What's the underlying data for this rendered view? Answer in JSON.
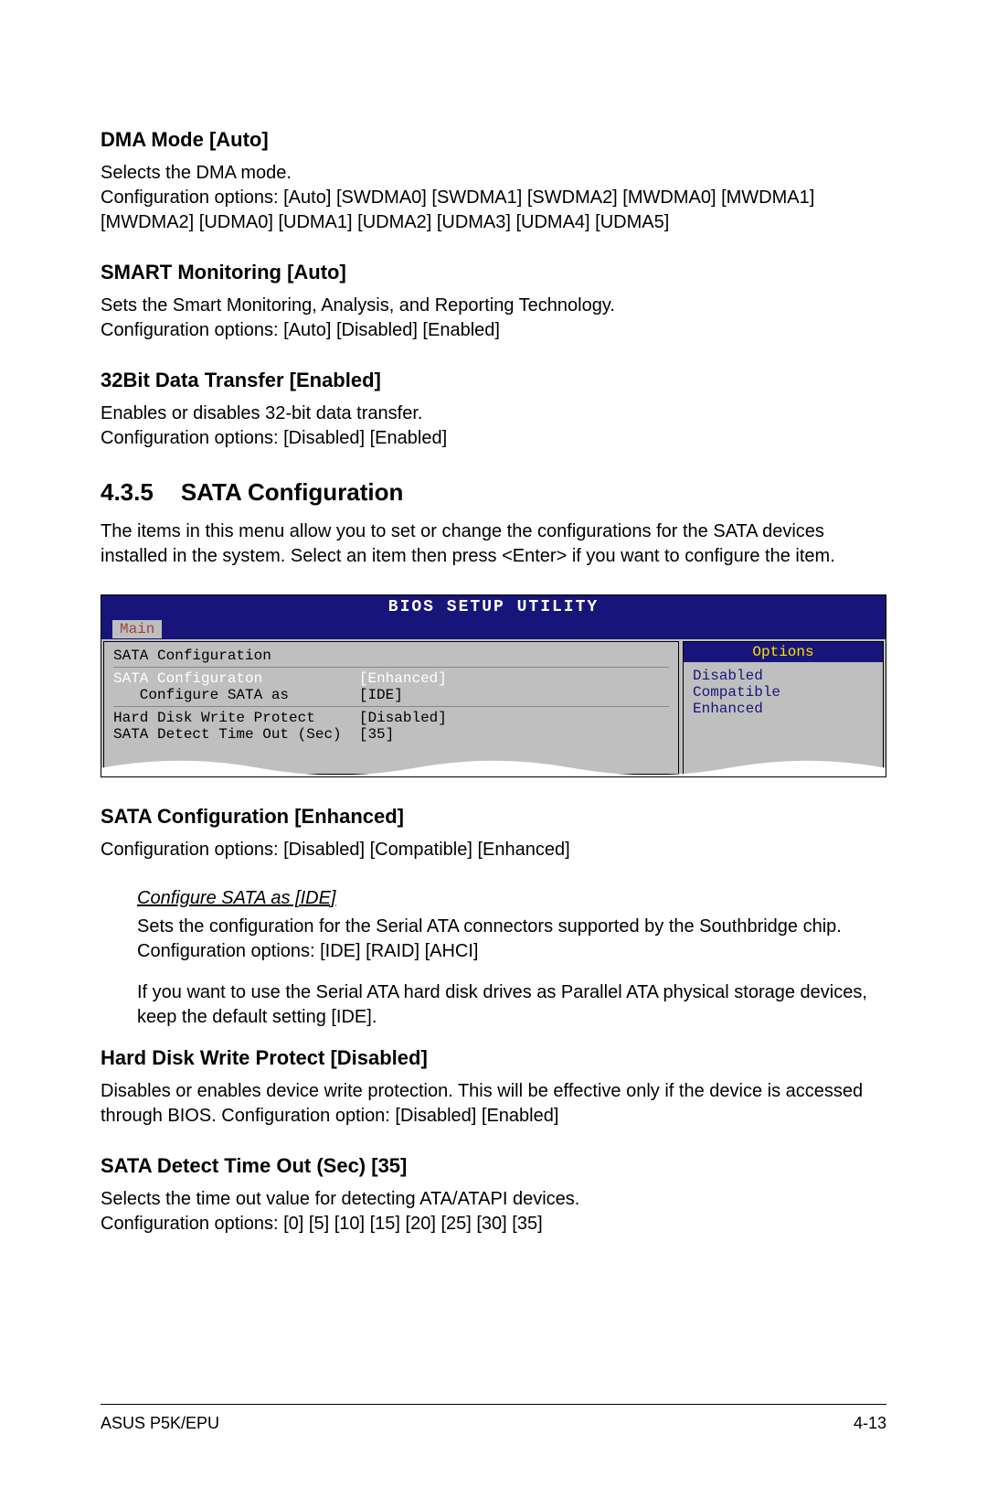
{
  "sections": {
    "dma": {
      "heading": "DMA Mode [Auto]",
      "body": "Selects the DMA mode.\nConfiguration options: [Auto] [SWDMA0] [SWDMA1] [SWDMA2] [MWDMA0] [MWDMA1] [MWDMA2] [UDMA0] [UDMA1] [UDMA2] [UDMA3] [UDMA4] [UDMA5]"
    },
    "smart": {
      "heading": "SMART Monitoring [Auto]",
      "body": "Sets the Smart Monitoring, Analysis, and Reporting Technology.\nConfiguration options: [Auto] [Disabled] [Enabled]"
    },
    "bit32": {
      "heading": "32Bit Data Transfer [Enabled]",
      "body": "Enables or disables 32-bit data transfer.\nConfiguration options: [Disabled] [Enabled]"
    },
    "sata_big": {
      "num": "4.3.5",
      "title": "SATA Configuration",
      "body": "The items in this menu allow you to set or change the configurations for the SATA devices installed in the system. Select an item then press <Enter> if you want to configure the item."
    },
    "sata_config": {
      "heading": "SATA Configuration [Enhanced]",
      "body": "Configuration options: [Disabled] [Compatible] [Enhanced]"
    },
    "config_sata_ide": {
      "sub": "Configure SATA as [IDE]",
      "p1": "Sets the configuration for the Serial ATA connectors supported by the Southbridge chip. Configuration options: [IDE] [RAID] [AHCI]",
      "p2": "If you want to use the Serial ATA hard disk drives as Parallel ATA physical storage devices, keep the default setting [IDE]."
    },
    "hd_write": {
      "heading": "Hard Disk Write Protect [Disabled]",
      "body": "Disables or enables device write protection. This will be effective only if the device is accessed through BIOS. Configuration option: [Disabled] [Enabled]"
    },
    "sata_detect": {
      "heading": "SATA Detect Time Out (Sec) [35]",
      "body": "Selects the time out value for detecting ATA/ATAPI devices.\nConfiguration options: [0] [5] [10] [15] [20] [25] [30] [35]"
    }
  },
  "bios": {
    "title": "BIOS SETUP UTILITY",
    "tab": "Main",
    "panel_title": "SATA Configuration",
    "rows": {
      "r1_label": "SATA Configuraton",
      "r1_value": "[Enhanced]",
      "r2_label": "   Configure SATA as",
      "r2_value": "[IDE]",
      "r3_label": "Hard Disk Write Protect",
      "r3_value": "[Disabled]",
      "r4_label": "SATA Detect Time Out (Sec)",
      "r4_value": "[35]"
    },
    "options_header": "Options",
    "options": {
      "o1": "Disabled",
      "o2": "Compatible",
      "o3": "Enhanced"
    }
  },
  "footer": {
    "left": "ASUS P5K/EPU",
    "right": "4-13"
  }
}
